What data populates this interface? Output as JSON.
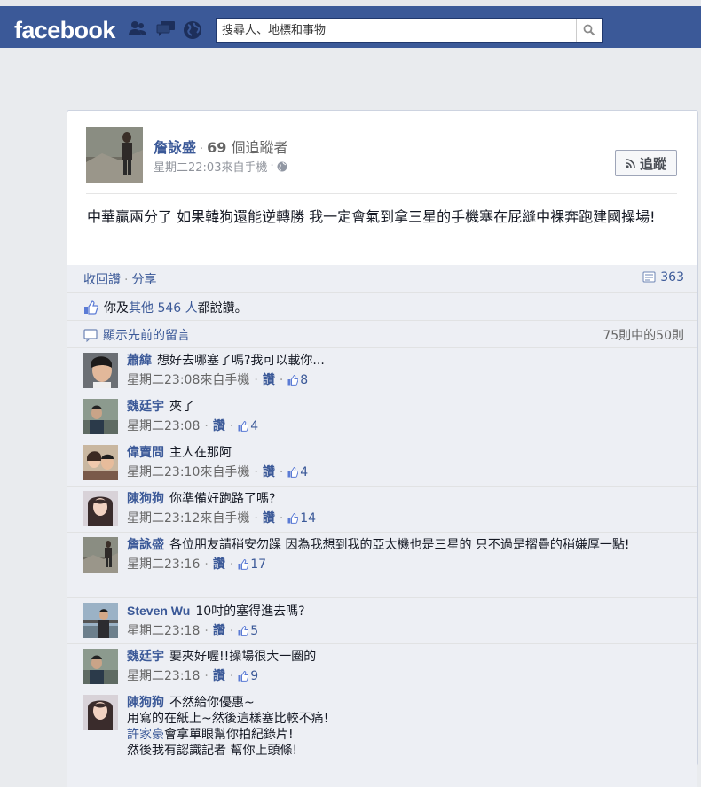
{
  "header": {
    "logo": "facebook",
    "search_placeholder": "搜尋人、地標和事物"
  },
  "post": {
    "author": "詹詠盛",
    "follower_count": "69",
    "follower_text": "個追蹤者",
    "timestamp": "星期二22:03",
    "source": "來自手機",
    "follow_label": "追蹤",
    "text": "中華贏兩分了 如果韓狗還能逆轉勝 我一定會氣到拿三星的手機塞在屁縫中裸奔跑建國操場!"
  },
  "ufi": {
    "unlike": "收回讚",
    "share": "分享",
    "share_count": "363",
    "likes_prefix": "你及",
    "likes_others": "其他 546 人",
    "likes_suffix": "都說讚。",
    "show_previous": "顯示先前的留言",
    "page_count": "75則中的50則"
  },
  "like_label": "讚",
  "comments": [
    {
      "name": "蕭緯",
      "text": "想好去哪塞了嗎?我可以載你...",
      "time": "星期二23:08",
      "source": "來自手機",
      "likes": "8"
    },
    {
      "name": "魏廷宇",
      "text": "夾了",
      "time": "星期二23:08",
      "likes": "4"
    },
    {
      "name": "偉賣問",
      "text": "主人在那阿",
      "time": "星期二23:10",
      "source": "來自手機",
      "likes": "4"
    },
    {
      "name": "陳狗狗",
      "text": "你準備好跑路了嗎?",
      "time": "星期二23:12",
      "source": "來自手機",
      "likes": "14"
    },
    {
      "name": "詹詠盛",
      "text": "各位朋友請稍安勿躁 因為我想到我的亞太機也是三星的 只不過是摺疊的稍嫌厚一點!",
      "time": "星期二23:16",
      "likes": "17"
    },
    {
      "name": "Steven Wu",
      "text": "10吋的塞得進去嗎?",
      "time": "星期二23:18",
      "likes": "5"
    },
    {
      "name": "魏廷宇",
      "text": "要夾好喔!!操場很大一圈的",
      "time": "星期二23:18",
      "likes": "9"
    },
    {
      "name": "陳狗狗",
      "text": "不然給你優惠~",
      "line2": "用寫的在紙上~然後這樣塞比較不痛!",
      "tag": "許家豪",
      "line3": "會拿單眼幫你拍紀錄片!",
      "line4": "然後我有認識記者 幫你上頭條!"
    }
  ],
  "colors": {
    "brand": "#3b5998",
    "ufi_bg": "#edeff4",
    "page_bg": "#e9ebee"
  }
}
